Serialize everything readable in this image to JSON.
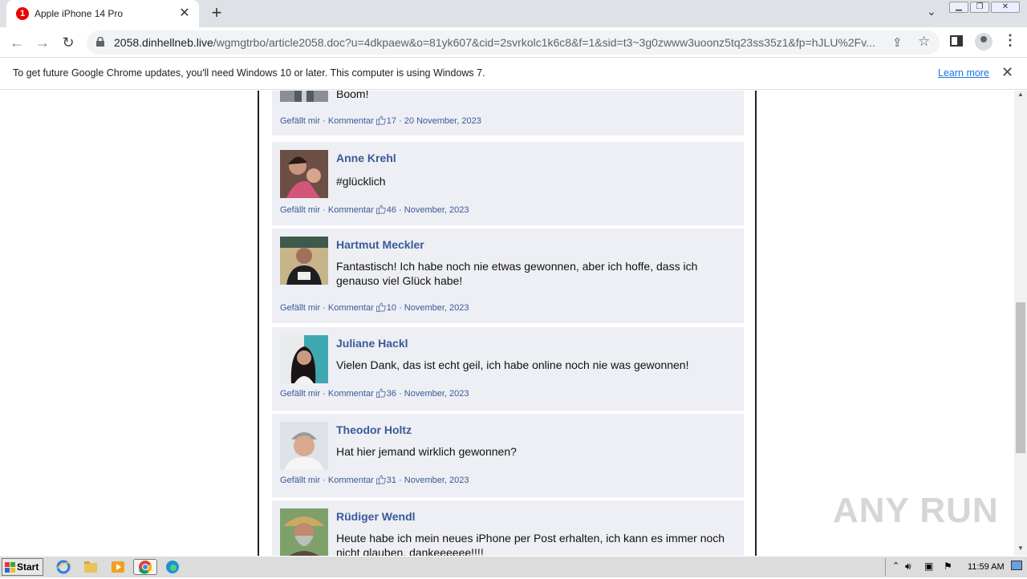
{
  "browser": {
    "tab_title": "Apple iPhone 14 Pro",
    "tab_favicon_text": "1",
    "url_host": "2058.dinhellneb.live",
    "url_path": "/wgmgtrbo/article2058.doc?u=4dkpaew&o=81yk607&cid=2svrkolc1k6c8&f=1&sid=t3~3g0zwww3uoonz5tq23ss35z1&fp=hJLU%2Fv...",
    "new_tab_symbol": "+",
    "close_symbol": "✕"
  },
  "infobar": {
    "message": "To get future Google Chrome updates, you'll need Windows 10 or later. This computer is using Windows 7.",
    "learn_more": "Learn more"
  },
  "comments": [
    {
      "name": "",
      "text": "Boom!",
      "like": "Gefällt mir",
      "comment": "Kommentar",
      "likes": "17",
      "date": "20 November, 2023"
    },
    {
      "name": "Anne Krehl",
      "text": "#glücklich",
      "like": "Gefällt mir",
      "comment": "Kommentar",
      "likes": "46",
      "date": "November, 2023"
    },
    {
      "name": "Hartmut Meckler",
      "text": "Fantastisch! Ich habe noch nie etwas gewonnen, aber ich hoffe, dass ich genauso viel Glück habe!",
      "like": "Gefällt mir",
      "comment": "Kommentar",
      "likes": "10",
      "date": "November, 2023"
    },
    {
      "name": "Juliane Hackl",
      "text": "Vielen Dank, das ist echt geil, ich habe online noch nie was gewonnen!",
      "like": "Gefällt mir",
      "comment": "Kommentar",
      "likes": "36",
      "date": "November, 2023"
    },
    {
      "name": "Theodor Holtz",
      "text": "Hat hier jemand wirklich gewonnen?",
      "like": "Gefällt mir",
      "comment": "Kommentar",
      "likes": "31",
      "date": "November, 2023"
    },
    {
      "name": "Rüdiger Wendl",
      "text": "Heute habe ich mein neues iPhone per Post erhalten, ich kann es immer noch nicht glauben, dankeeeeee!!!!",
      "like": "",
      "comment": "",
      "likes": "",
      "date": ""
    }
  ],
  "separator": " · ",
  "watermark": "ANY RUN",
  "taskbar": {
    "start": "Start",
    "clock": "11:59 AM"
  },
  "colors": {
    "link": "#3b5998",
    "comment_bg": "#edeff4",
    "tab_strip": "#dee1e6"
  }
}
